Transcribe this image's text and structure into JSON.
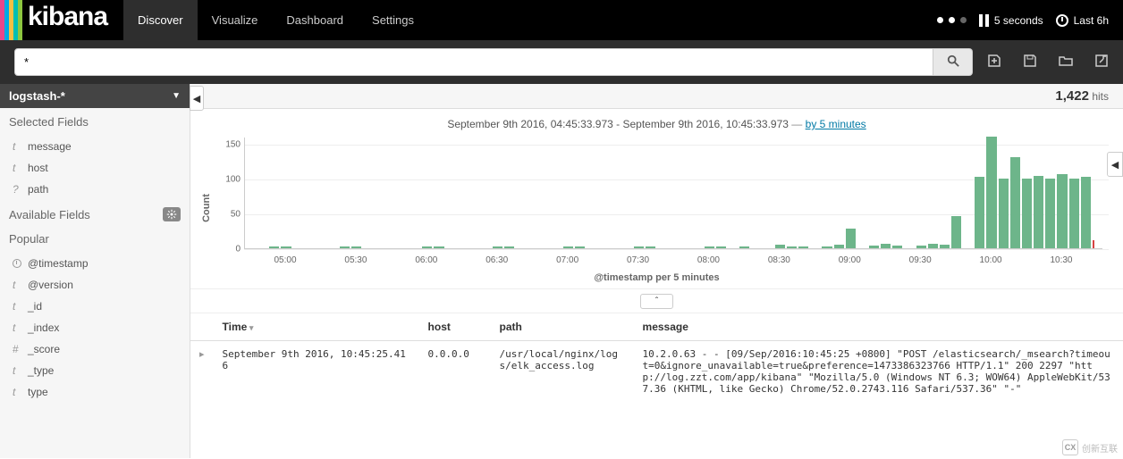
{
  "branding": {
    "name": "kibana"
  },
  "nav": {
    "tabs": [
      "Discover",
      "Visualize",
      "Dashboard",
      "Settings"
    ],
    "activeTab": 0,
    "refreshInterval": "5 seconds",
    "timeRange": "Last 6h"
  },
  "search": {
    "query": "*"
  },
  "sidebar": {
    "indexPattern": "logstash-*",
    "selectedFieldsLabel": "Selected Fields",
    "availableFieldsLabel": "Available Fields",
    "popularLabel": "Popular",
    "selectedFields": [
      {
        "type": "str",
        "name": "message"
      },
      {
        "type": "str",
        "name": "host"
      },
      {
        "type": "unk",
        "name": "path"
      }
    ],
    "popularFields": [
      {
        "type": "clk",
        "name": "@timestamp"
      },
      {
        "type": "str",
        "name": "@version"
      },
      {
        "type": "str",
        "name": "_id"
      },
      {
        "type": "str",
        "name": "_index"
      },
      {
        "type": "num",
        "name": "_score"
      },
      {
        "type": "str",
        "name": "_type"
      },
      {
        "type": "str",
        "name": "type"
      }
    ]
  },
  "hits": {
    "count": "1,422",
    "label": "hits"
  },
  "timeHeader": {
    "from": "September 9th 2016, 04:45:33.973",
    "to": "September 9th 2016, 10:45:33.973",
    "dash": "—",
    "by": "by 5 minutes"
  },
  "chart_data": {
    "type": "bar",
    "xlabel": "@timestamp per 5 minutes",
    "ylabel": "Count",
    "ylim": [
      0,
      160
    ],
    "yticks": [
      0,
      50,
      100,
      150
    ],
    "xticks": [
      "05:00",
      "05:30",
      "06:00",
      "06:30",
      "07:00",
      "07:30",
      "08:00",
      "08:30",
      "09:00",
      "09:30",
      "10:00",
      "10:30"
    ],
    "categories": [
      "04:45",
      "04:50",
      "04:55",
      "05:00",
      "05:05",
      "05:10",
      "05:15",
      "05:20",
      "05:25",
      "05:30",
      "05:35",
      "05:40",
      "05:45",
      "05:50",
      "05:55",
      "06:00",
      "06:05",
      "06:10",
      "06:15",
      "06:20",
      "06:25",
      "06:30",
      "06:35",
      "06:40",
      "06:45",
      "06:50",
      "06:55",
      "07:00",
      "07:05",
      "07:10",
      "07:15",
      "07:20",
      "07:25",
      "07:30",
      "07:35",
      "07:40",
      "07:45",
      "07:50",
      "07:55",
      "08:00",
      "08:05",
      "08:10",
      "08:15",
      "08:20",
      "08:25",
      "08:30",
      "08:35",
      "08:40",
      "08:45",
      "08:50",
      "08:55",
      "09:00",
      "09:05",
      "09:10",
      "09:15",
      "09:20",
      "09:25",
      "09:30",
      "09:35",
      "09:40",
      "09:45",
      "09:50",
      "09:55",
      "10:00",
      "10:05",
      "10:10",
      "10:15",
      "10:20",
      "10:25",
      "10:30",
      "10:35",
      "10:40",
      "10:45"
    ],
    "values": [
      0,
      0,
      2,
      3,
      0,
      0,
      0,
      0,
      2,
      3,
      0,
      0,
      0,
      0,
      0,
      2,
      3,
      0,
      0,
      0,
      0,
      2,
      2,
      0,
      0,
      0,
      0,
      2,
      3,
      0,
      0,
      0,
      0,
      2,
      3,
      0,
      0,
      0,
      0,
      2,
      2,
      0,
      3,
      0,
      0,
      5,
      3,
      3,
      0,
      3,
      5,
      28,
      0,
      4,
      6,
      4,
      0,
      4,
      6,
      5,
      46,
      0,
      102,
      160,
      100,
      130,
      100,
      104,
      100,
      106,
      100,
      103,
      12
    ],
    "indicator_index": 72
  },
  "table": {
    "columns": [
      "Time",
      "host",
      "path",
      "message"
    ],
    "rows": [
      {
        "time": "September 9th 2016, 10:45:25.416",
        "host": "0.0.0.0",
        "path": "/usr/local/nginx/logs/elk_access.log",
        "message": "10.2.0.63 - - [09/Sep/2016:10:45:25 +0800] \"POST /elasticsearch/_msearch?timeout=0&ignore_unavailable=true&preference=1473386323766 HTTP/1.1\" 200 2297 \"http://log.zzt.com/app/kibana\" \"Mozilla/5.0 (Windows NT 6.3; WOW64) AppleWebKit/537.36 (KHTML, like Gecko) Chrome/52.0.2743.116 Safari/537.36\" \"-\""
      }
    ]
  },
  "watermark": {
    "text": "创新互联"
  }
}
